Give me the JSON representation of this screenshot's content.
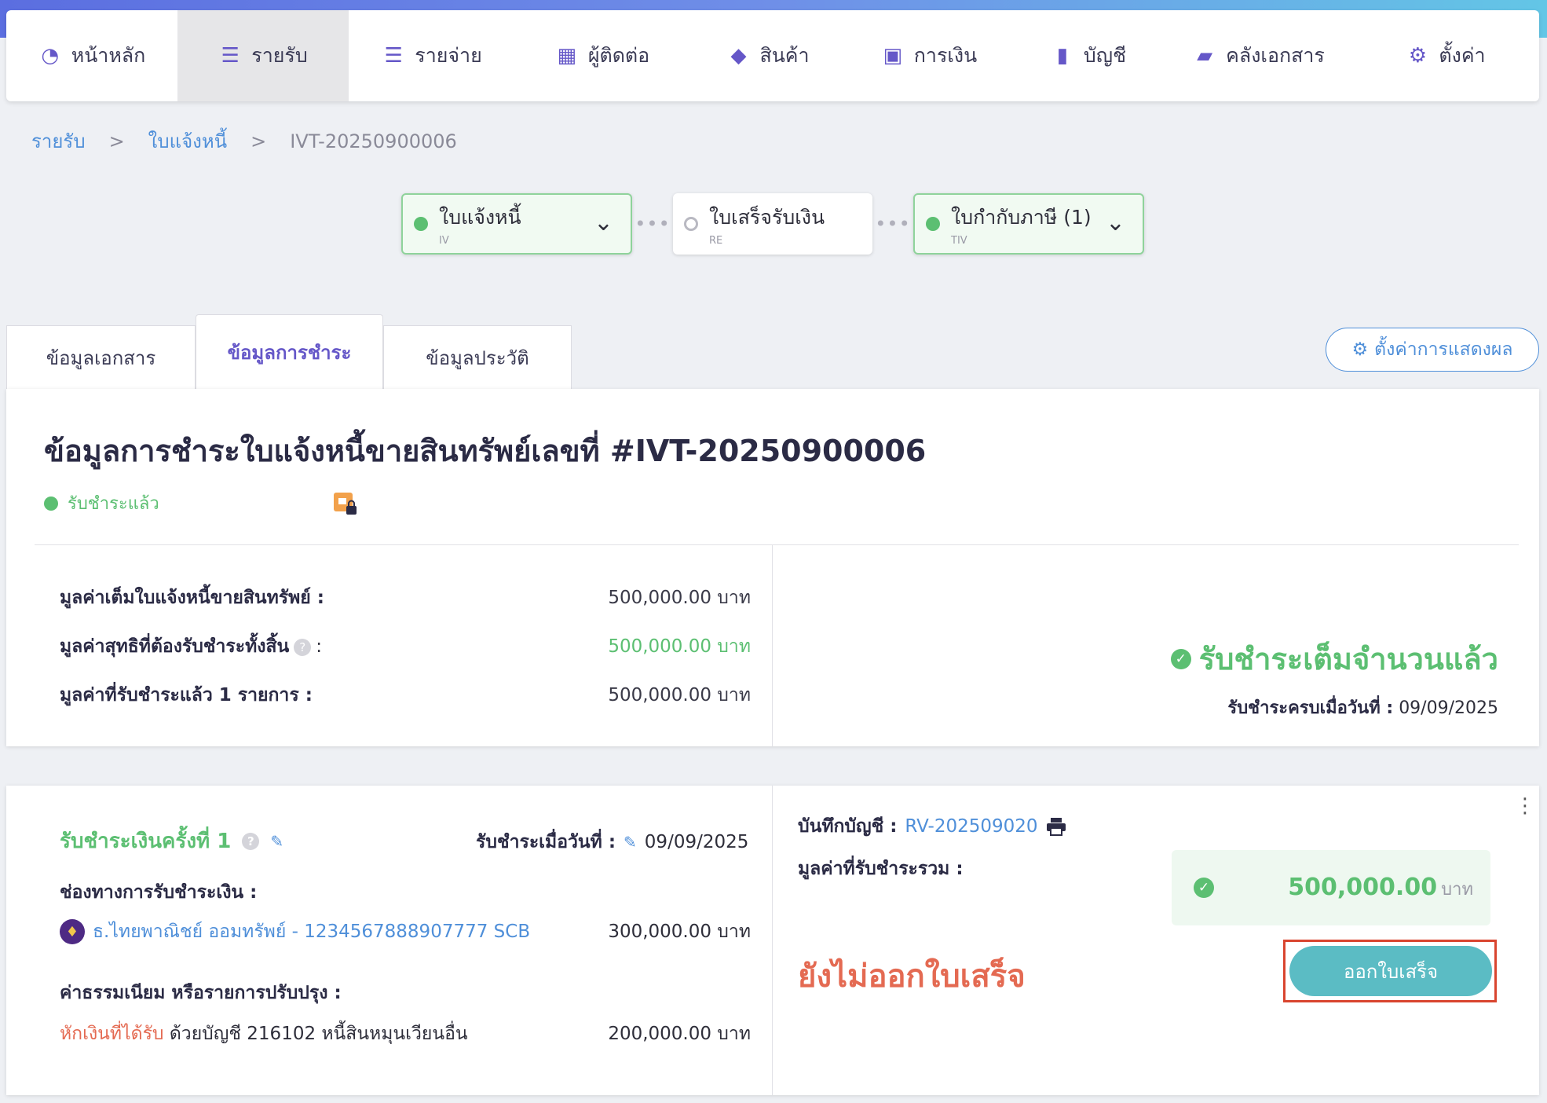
{
  "nav": [
    {
      "label": "หน้าหลัก",
      "icon": "dashboard-icon",
      "active": false
    },
    {
      "label": "รายรับ",
      "icon": "income-icon",
      "active": true
    },
    {
      "label": "รายจ่าย",
      "icon": "expense-icon",
      "active": false
    },
    {
      "label": "ผู้ติดต่อ",
      "icon": "contacts-icon",
      "active": false
    },
    {
      "label": "สินค้า",
      "icon": "product-box-icon",
      "active": false
    },
    {
      "label": "การเงิน",
      "icon": "money-icon",
      "active": false
    },
    {
      "label": "บัญชี",
      "icon": "ledger-icon",
      "active": false
    },
    {
      "label": "คลังเอกสาร",
      "icon": "folder-icon",
      "active": false
    },
    {
      "label": "ตั้งค่า",
      "icon": "gear-icon",
      "active": false
    }
  ],
  "breadcrumb": {
    "level1": "รายรับ",
    "level2": "ใบแจ้งหนี้",
    "current": "IVT-20250900006",
    "sep": ">"
  },
  "flow": [
    {
      "title": "ใบแจ้งหนี้",
      "code": "IV",
      "status": "done"
    },
    {
      "title": "ใบเสร็จรับเงิน",
      "code": "RE",
      "status": "pending"
    },
    {
      "title": "ใบกำกับภาษี (1)",
      "code": "TIV",
      "status": "done"
    }
  ],
  "tabs": [
    "ข้อมูลเอกสาร",
    "ข้อมูลการชำระ",
    "ข้อมูลประวัติ"
  ],
  "display_settings_label": "ตั้งค่าการแสดงผล",
  "summary": {
    "title": "ข้อมูลการชำระใบแจ้งหนี้ขายสินทรัพย์เลขที่ #IVT-20250900006",
    "status": "รับชำระแล้ว",
    "rows": [
      {
        "label": "มูลค่าเต็มใบแจ้งหนี้ขายสินทรัพย์ :",
        "value": "500,000.00 บาท"
      },
      {
        "label": "มูลค่าสุทธิที่ต้องรับชำระทั้งสิ้น",
        "suffix": ":",
        "value": "500,000.00 บาท"
      },
      {
        "label": "มูลค่าที่รับชำระแล้ว 1 รายการ :",
        "value": "500,000.00 บาท"
      }
    ],
    "full_paid_text": "รับชำระเต็มจำนวนแล้ว",
    "paid_date_label": "รับชำระครบเมื่อวันที่ :",
    "paid_date": "09/09/2025"
  },
  "payment": {
    "title": "รับชำระเงินครั้งที่ 1",
    "date_label": "รับชำระเมื่อวันที่ :",
    "date": "09/09/2025",
    "channel_label": "ช่องทางการรับชำระเงิน :",
    "bank_text": "ธ.ไทยพาณิชย์ ออมทรัพย์ - 1234567888907777 SCB",
    "bank_amount": "300,000.00 บาท",
    "fee_label": "ค่าธรรมเนียม หรือรายการปรับปรุง :",
    "deduct_label": "หักเงินที่ได้รับ",
    "deduct_text": "ด้วยบัญชี 216102 หนี้สินหมุนเวียนอื่น",
    "deduct_amount": "200,000.00 บาท",
    "account_record_label": "บันทึกบัญชี :",
    "account_record": "RV-202509020",
    "total_label": "มูลค่าที่รับชำระรวม :",
    "total_amount": "500,000.00",
    "total_unit": "บาท",
    "not_issued": "ยังไม่ออกใบเสร็จ",
    "issue_button": "ออกใบเสร็จ"
  }
}
